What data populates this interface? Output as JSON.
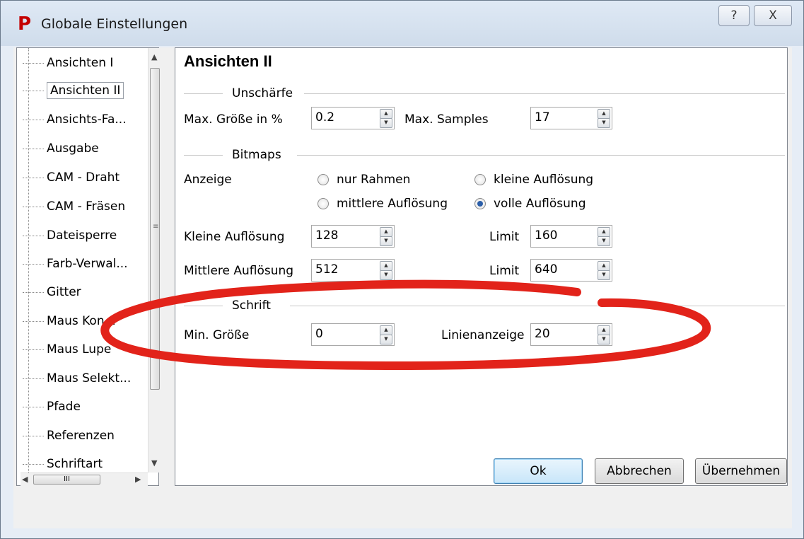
{
  "window": {
    "title": "Globale Einstellungen",
    "app_icon": "P",
    "help_label": "?",
    "close_label": "X"
  },
  "tree": {
    "items": [
      {
        "label": "Ansichten I"
      },
      {
        "label": "Ansichten II",
        "selected": true
      },
      {
        "label": "Ansichts-Fa..."
      },
      {
        "label": "Ausgabe"
      },
      {
        "label": "CAM - Draht"
      },
      {
        "label": "CAM - Fräsen"
      },
      {
        "label": "Dateisperre"
      },
      {
        "label": "Farb-Verwal..."
      },
      {
        "label": "Gitter"
      },
      {
        "label": "Maus Kon..."
      },
      {
        "label": "Maus Lupe"
      },
      {
        "label": "Maus Selekt..."
      },
      {
        "label": "Pfade"
      },
      {
        "label": "Referenzen"
      },
      {
        "label": "Schriftart"
      }
    ],
    "hscroll_thumb": "III"
  },
  "panel": {
    "title": "Ansichten II",
    "unschaerfe": {
      "group_label": "Unschärfe",
      "max_groesse_label": "Max. Größe in %",
      "max_groesse_value": "0.2",
      "max_samples_label": "Max. Samples",
      "max_samples_value": "17"
    },
    "bitmaps": {
      "group_label": "Bitmaps",
      "anzeige_label": "Anzeige",
      "options": [
        "nur Rahmen",
        "kleine Auflösung",
        "mittlere Auflösung",
        "volle Auflösung"
      ],
      "selected_option": "volle Auflösung",
      "kleine_label": "Kleine Auflösung",
      "kleine_value": "128",
      "kleine_limit_label": "Limit",
      "kleine_limit_value": "160",
      "mittlere_label": "Mittlere Auflösung",
      "mittlere_value": "512",
      "mittlere_limit_label": "Limit",
      "mittlere_limit_value": "640"
    },
    "schrift": {
      "group_label": "Schrift",
      "min_groesse_label": "Min. Größe",
      "min_groesse_value": "0",
      "linienanzeige_label": "Linienanzeige",
      "linienanzeige_value": "20"
    }
  },
  "buttons": {
    "ok": "Ok",
    "abbrechen": "Abbrechen",
    "uebernehmen": "Übernehmen"
  },
  "colors": {
    "annotation": "#e2231a",
    "app_icon": "#c40000"
  }
}
